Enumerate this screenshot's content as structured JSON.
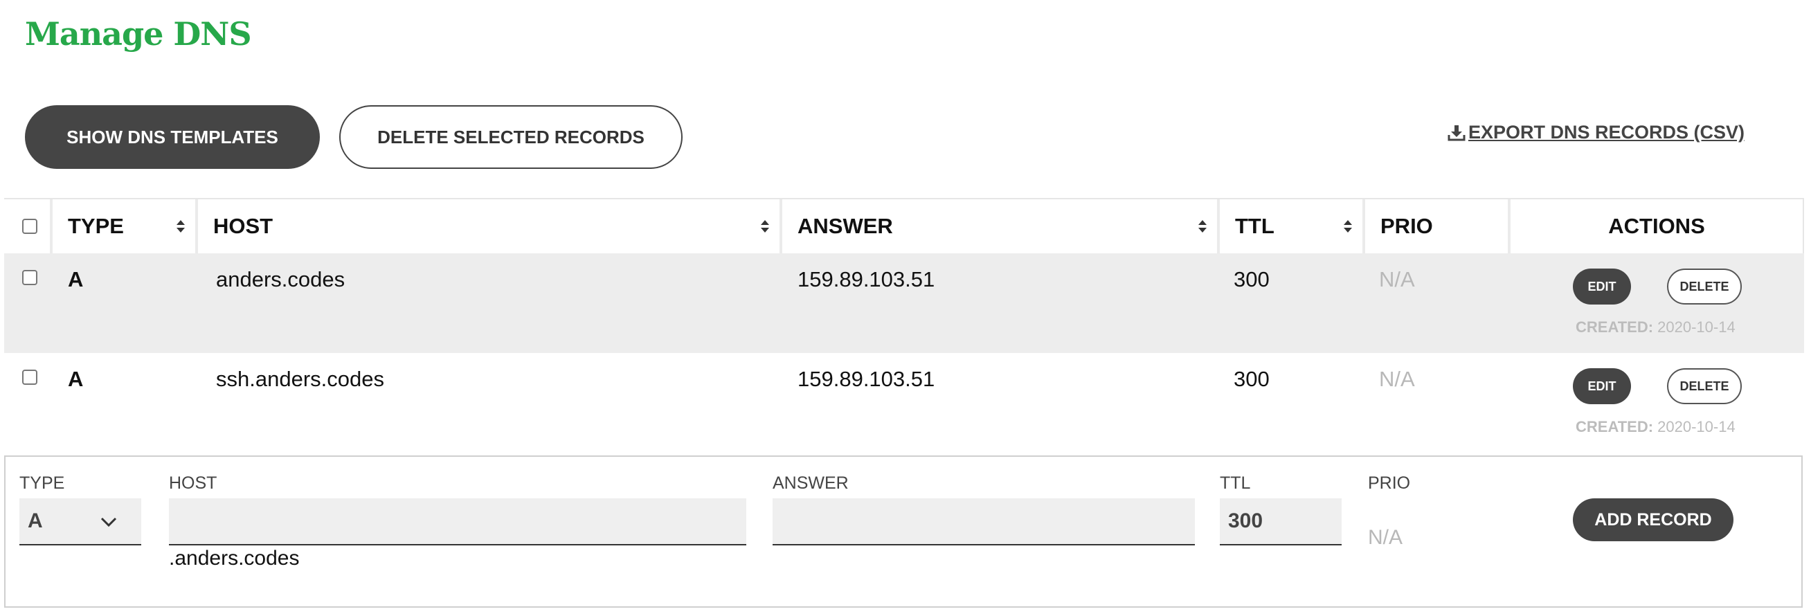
{
  "page": {
    "title": "Manage DNS"
  },
  "toolbar": {
    "show_templates_label": "SHOW DNS TEMPLATES",
    "delete_selected_label": "DELETE SELECTED RECORDS",
    "export_label": "EXPORT DNS RECORDS (CSV)"
  },
  "table": {
    "headers": {
      "type": "TYPE",
      "host": "HOST",
      "answer": "ANSWER",
      "ttl": "TTL",
      "prio": "PRIO",
      "actions": "ACTIONS"
    },
    "rows": [
      {
        "type": "A",
        "host": "anders.codes",
        "answer": "159.89.103.51",
        "ttl": "300",
        "prio": "N/A",
        "edit_label": "EDIT",
        "delete_label": "DELETE",
        "created_label": "CREATED:",
        "created_date": "2020-10-14"
      },
      {
        "type": "A",
        "host": "ssh.anders.codes",
        "answer": "159.89.103.51",
        "ttl": "300",
        "prio": "N/A",
        "edit_label": "EDIT",
        "delete_label": "DELETE",
        "created_label": "CREATED:",
        "created_date": "2020-10-14"
      }
    ]
  },
  "add_form": {
    "type_label": "TYPE",
    "type_value": "A",
    "host_label": "HOST",
    "host_value": "",
    "host_suffix": ".anders.codes",
    "answer_label": "ANSWER",
    "answer_value": "",
    "ttl_label": "TTL",
    "ttl_value": "300",
    "prio_label": "PRIO",
    "prio_value": "N/A",
    "add_label": "ADD RECORD"
  },
  "icons": {
    "export": "download-icon",
    "sort": "sort-icon",
    "dropdown": "chevron-down-icon"
  },
  "colors": {
    "brand": "#27a84a",
    "button_dark": "#454545",
    "row_shade": "#ededed",
    "muted": "#b8b8b8"
  }
}
